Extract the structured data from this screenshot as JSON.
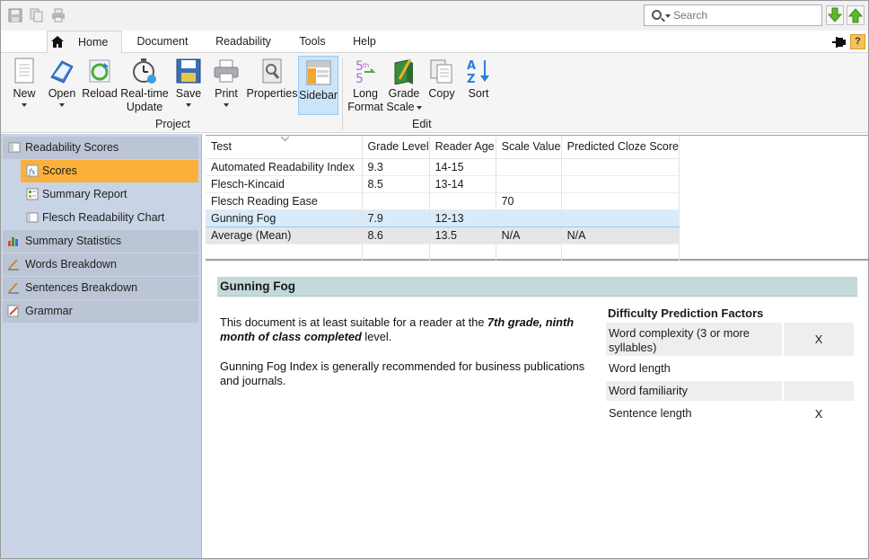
{
  "search": {
    "placeholder": "Search"
  },
  "tabs": [
    {
      "label": "Home"
    },
    {
      "label": "Document"
    },
    {
      "label": "Readability"
    },
    {
      "label": "Tools"
    },
    {
      "label": "Help"
    }
  ],
  "help_badge": "?",
  "ribbon": {
    "new": "New",
    "open": "Open",
    "reload": "Reload",
    "realtime_1": "Real-time",
    "realtime_2": "Update",
    "save": "Save",
    "print": "Print",
    "properties": "Properties",
    "sidebar": "Sidebar",
    "long_format_1": "Long",
    "long_format_2": "Format",
    "grade_scale_1": "Grade",
    "grade_scale_2": "Scale",
    "copy": "Copy",
    "sort": "Sort",
    "group_project": "Project",
    "group_edit": "Edit"
  },
  "sidebar": {
    "items": [
      {
        "label": "Readability Scores"
      },
      {
        "label": "Scores"
      },
      {
        "label": "Summary Report"
      },
      {
        "label": "Flesch Readability Chart"
      },
      {
        "label": "Summary Statistics"
      },
      {
        "label": "Words Breakdown"
      },
      {
        "label": "Sentences Breakdown"
      },
      {
        "label": "Grammar"
      }
    ]
  },
  "grid": {
    "headers": [
      "Test",
      "Grade Level",
      "Reader Age",
      "Scale Value",
      "Predicted Cloze Score"
    ],
    "rows": [
      [
        "Automated Readability Index",
        "9.3",
        "14-15",
        "",
        ""
      ],
      [
        "Flesch-Kincaid",
        "8.5",
        "13-14",
        "",
        ""
      ],
      [
        "Flesch Reading Ease",
        "",
        "",
        "70",
        ""
      ],
      [
        "Gunning Fog",
        "7.9",
        "12-13",
        "",
        ""
      ],
      [
        "Average (Mean)",
        "8.6",
        "13.5",
        "N/A",
        "N/A"
      ]
    ]
  },
  "detail": {
    "title": "Gunning Fog",
    "p1_a": "This document is at least suitable for a reader at the ",
    "p1_b": "7th grade, ninth month of class completed",
    "p1_c": " level.",
    "p2": "Gunning Fog Index is generally recommended for business publications and journals.",
    "factors_title": "Difficulty Prediction Factors",
    "factors": [
      {
        "label": "Word complexity (3 or more syllables)",
        "mark": "X"
      },
      {
        "label": "Word length",
        "mark": ""
      },
      {
        "label": "Word familiarity",
        "mark": ""
      },
      {
        "label": "Sentence length",
        "mark": "X"
      }
    ]
  }
}
